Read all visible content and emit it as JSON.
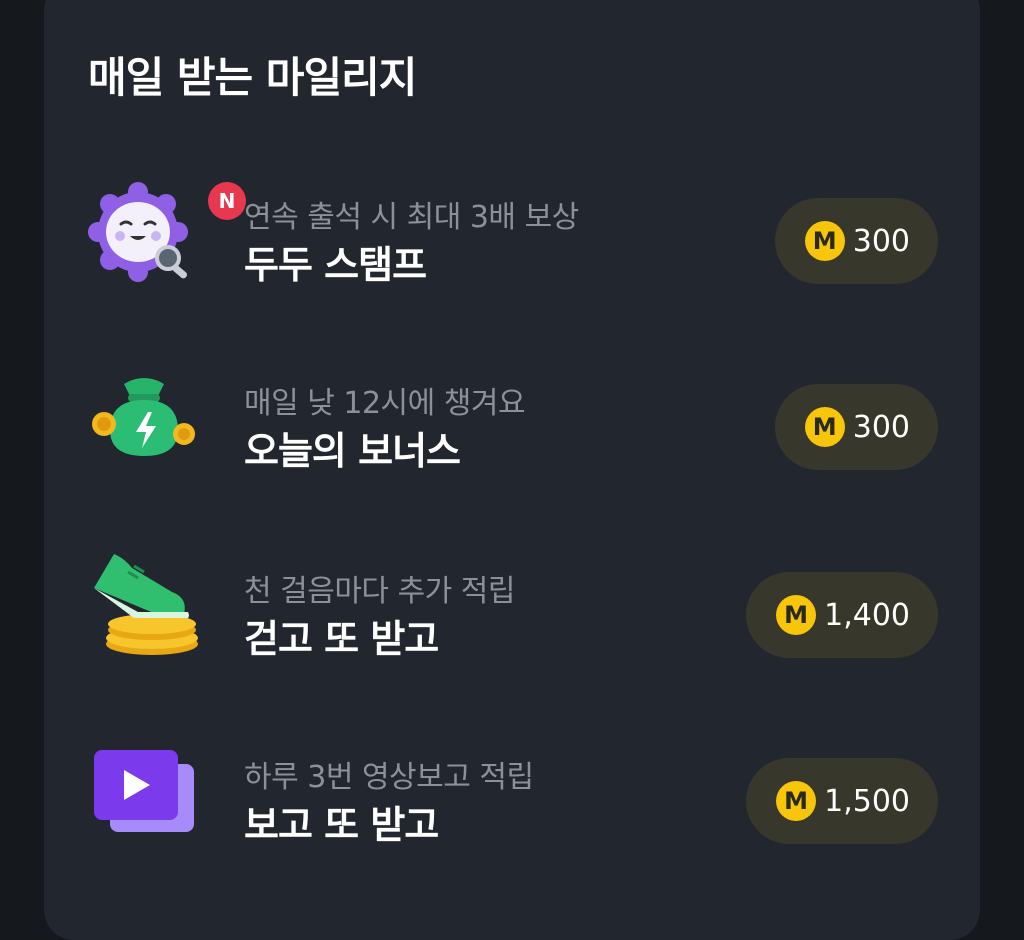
{
  "section": {
    "title": "매일 받는 마일리지"
  },
  "items": [
    {
      "subtitle": "연속 출석 시 최대 3배 보상",
      "name": "두두 스탬프",
      "coin_symbol": "M",
      "amount": "300",
      "badge": "N",
      "icon": "stamp-character-icon"
    },
    {
      "subtitle": "매일 낮 12시에 챙겨요",
      "name": "오늘의 보너스",
      "coin_symbol": "M",
      "amount": "300",
      "icon": "money-pouch-icon"
    },
    {
      "subtitle": "천 걸음마다 추가 적립",
      "name": "걷고 또 받고",
      "coin_symbol": "M",
      "amount": "1,400",
      "icon": "sneaker-coins-icon"
    },
    {
      "subtitle": "하루 3번 영상보고 적립",
      "name": "보고 또 받고",
      "coin_symbol": "M",
      "amount": "1,500",
      "icon": "video-play-icon"
    }
  ],
  "colors": {
    "background": "#15181d",
    "card": "#22262e",
    "pill": "#38372b",
    "coin": "#f7c50a",
    "badge": "#e8384f"
  }
}
